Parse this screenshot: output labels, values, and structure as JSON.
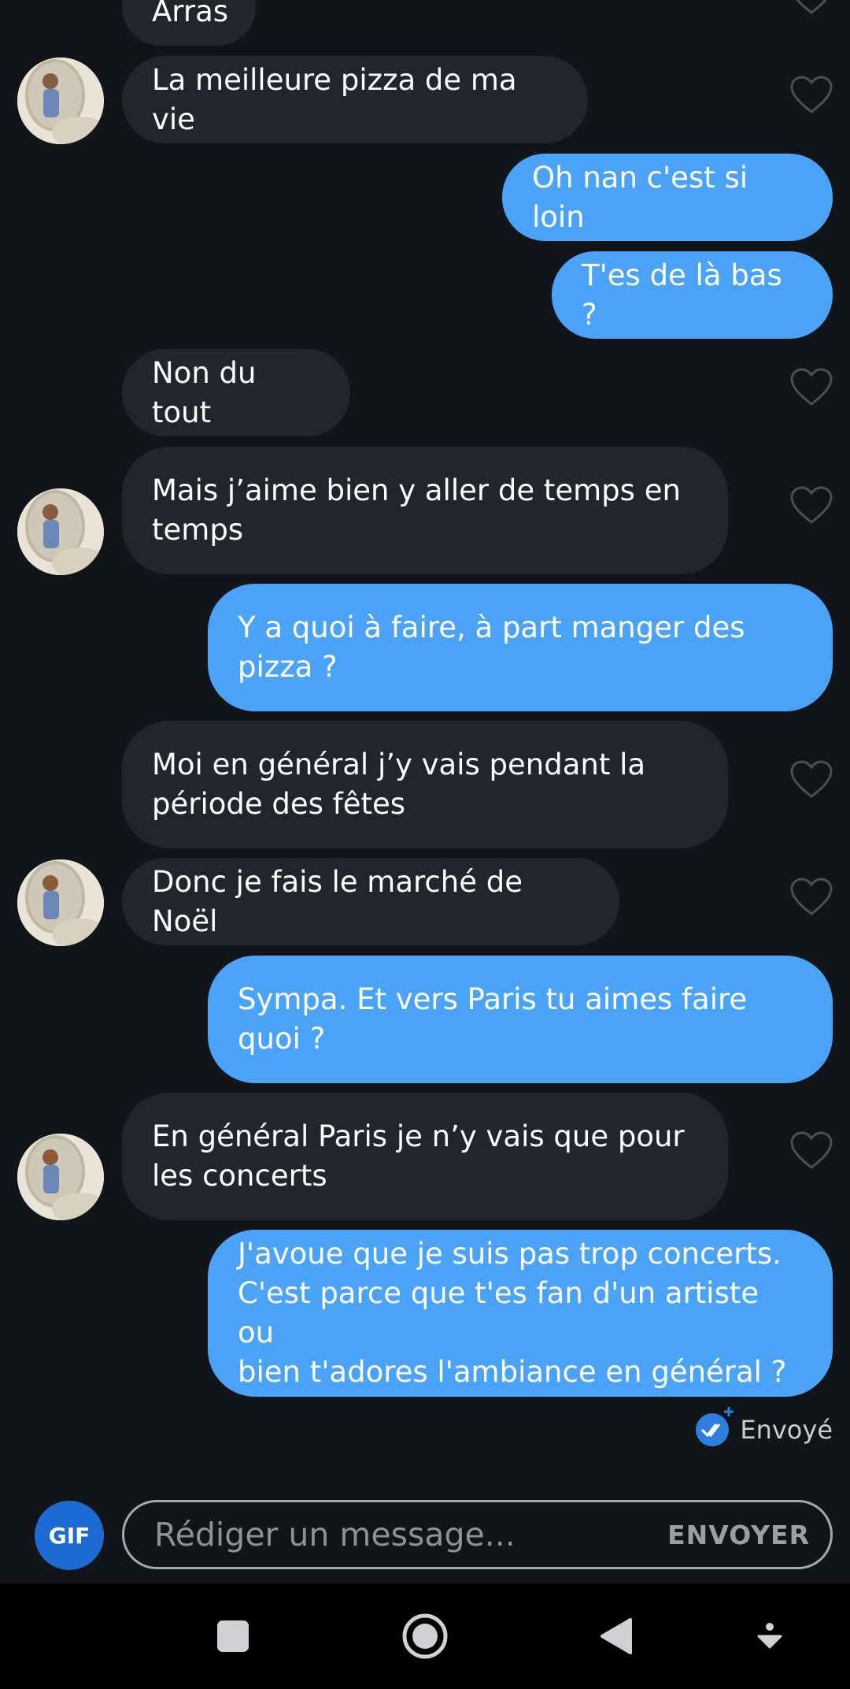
{
  "conversation": {
    "messages": [
      {
        "side": "received",
        "text": "Arras"
      },
      {
        "side": "received",
        "text": "La meilleure pizza de ma vie"
      },
      {
        "side": "sent",
        "text": "Oh nan c'est si loin"
      },
      {
        "side": "sent",
        "text": "T'es de là bas ?"
      },
      {
        "side": "received",
        "text": "Non du tout"
      },
      {
        "side": "received",
        "text": "Mais j’aime bien y aller de temps en\ntemps"
      },
      {
        "side": "sent",
        "text": "Y a quoi à faire, à part manger des\npizza ?"
      },
      {
        "side": "received",
        "text": "Moi en général j’y vais pendant la\npériode des fêtes"
      },
      {
        "side": "received",
        "text": "Donc je fais le marché de Noël"
      },
      {
        "side": "sent",
        "text": "Sympa. Et vers Paris tu aimes faire\nquoi ?"
      },
      {
        "side": "received",
        "text": "En général Paris je n’y vais que pour\nles concerts"
      },
      {
        "side": "sent",
        "text": "J'avoue que je suis pas trop concerts.\nC'est parce que t'es fan d'un artiste ou\nbien t'adores l'ambiance en général ?"
      }
    ],
    "status": "Envoyé"
  },
  "composer": {
    "gif_label": "GIF",
    "placeholder": "Rédiger un message...",
    "send_label": "ENVOYER"
  },
  "icons": {
    "like": "heart-icon",
    "delivered": "double-check-icon",
    "nav": [
      "recents-square-icon",
      "home-circle-icon",
      "back-triangle-icon",
      "notification-down-icon"
    ]
  },
  "colors": {
    "background": "#111418",
    "received_bubble": "#21252d",
    "sent_bubble": "#4aa3f7",
    "gif_button": "#1d6ad2"
  }
}
